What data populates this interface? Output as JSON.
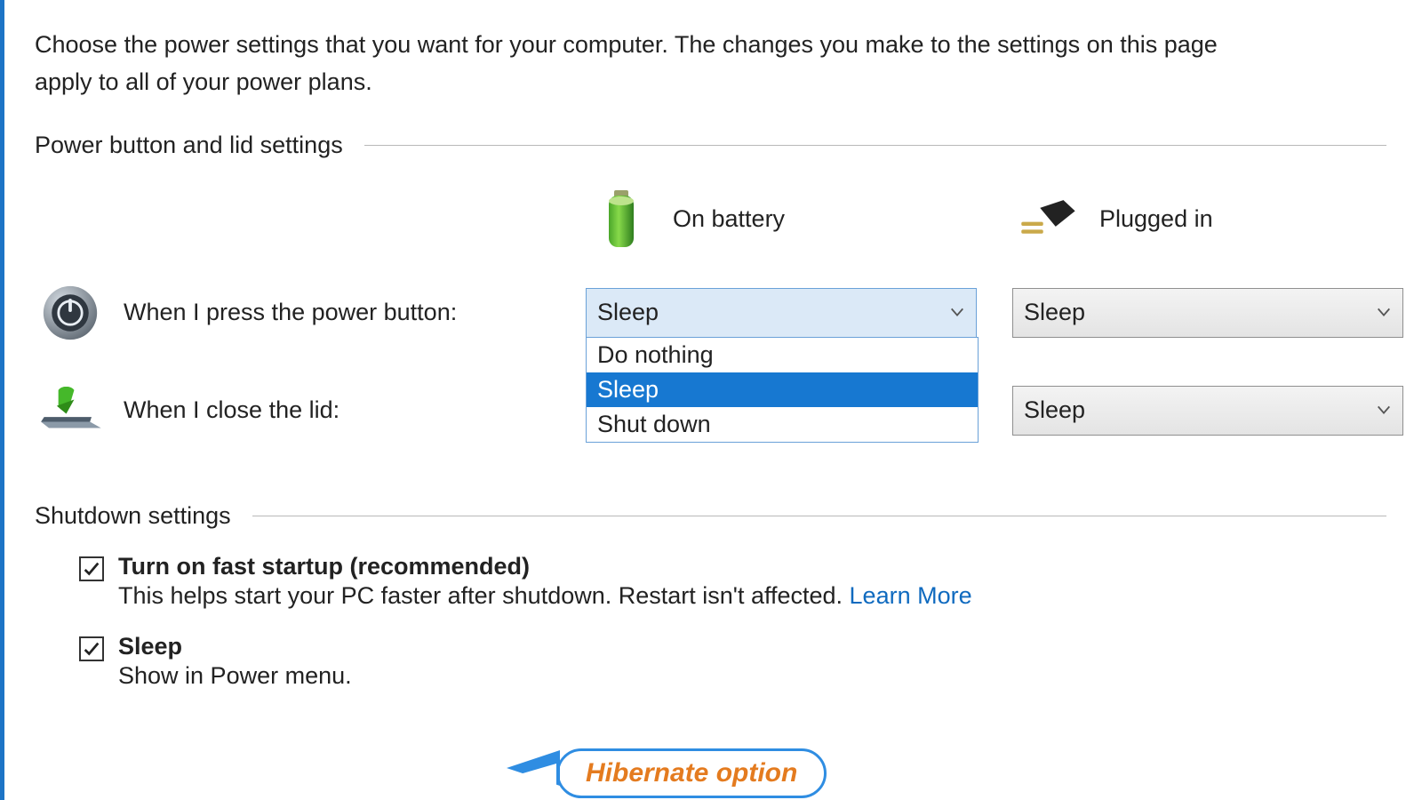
{
  "intro": "Choose the power settings that you want for your computer. The changes you make to the settings on this page apply to all of your power plans.",
  "sections": {
    "power_lid_title": "Power button and lid settings",
    "shutdown_title": "Shutdown settings"
  },
  "columns": {
    "battery": "On battery",
    "plugged": "Plugged in"
  },
  "rows": {
    "power_button": "When I press the power button:",
    "close_lid": "When I close the lid:"
  },
  "values": {
    "power_button_battery": "Sleep",
    "power_button_plugged": "Sleep",
    "close_lid_plugged": "Sleep"
  },
  "dropdown_options": {
    "opt1": "Do nothing",
    "opt2": "Sleep",
    "opt3": "Shut down"
  },
  "shutdown": {
    "fast_startup_title": "Turn on fast startup (recommended)",
    "fast_startup_desc": "This helps start your PC faster after shutdown. Restart isn't affected. ",
    "learn_more": "Learn More",
    "sleep_title": "Sleep",
    "sleep_desc": "Show in Power menu."
  },
  "annotation": "Hibernate option"
}
